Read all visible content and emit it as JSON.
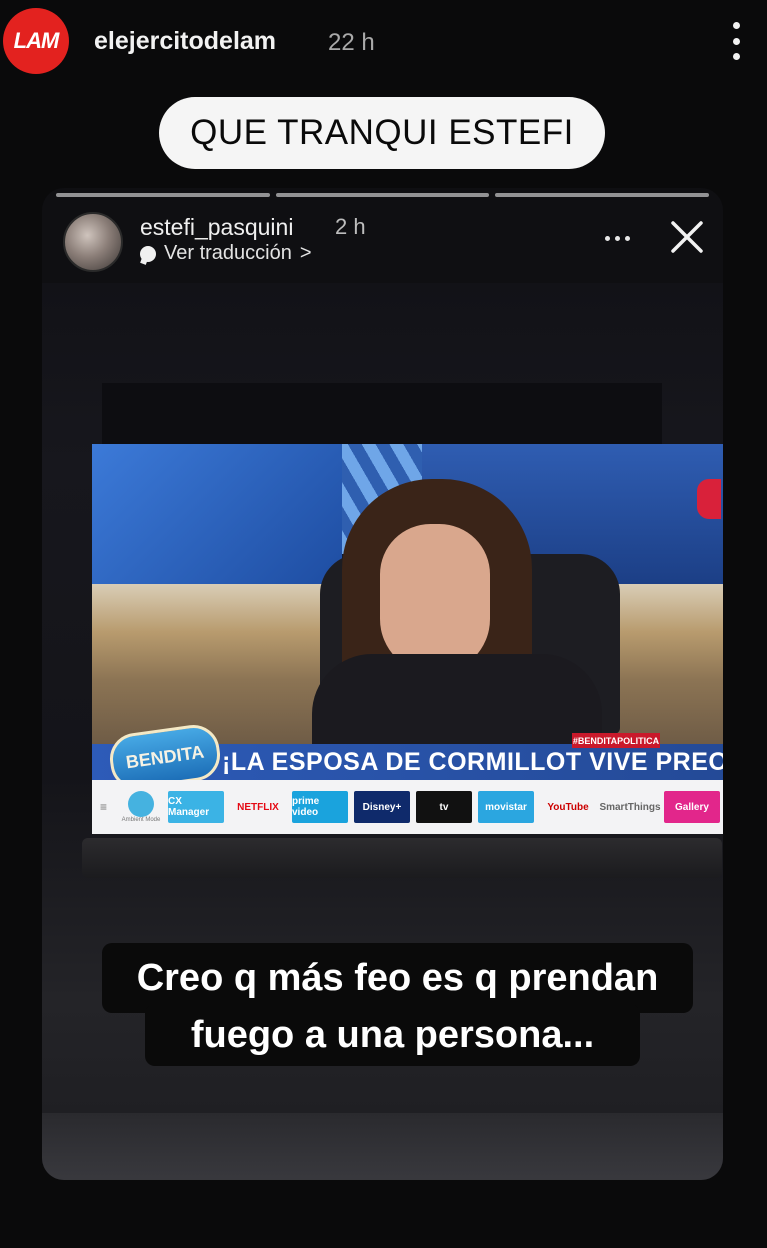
{
  "outer_story": {
    "avatar_text": "LAM",
    "username": "elejercitodelam",
    "time": "22 h",
    "caption": "QUE TRANQUI ESTEFI"
  },
  "inner_story": {
    "username": "estefi_pasquini",
    "time": "2 h",
    "translate_label": "Ver traducción",
    "translate_chevron": ">",
    "progress_segments": 3,
    "subtitle_line1": "Creo q más feo es q prendan",
    "subtitle_line2": "fuego a una persona..."
  },
  "tv": {
    "show_logo": "BENDITA",
    "hashtag": "#BENDITAPOLITICA",
    "banner": "¡LA ESPOSA DE CORMILLOT VIVE PREOCUPADA!",
    "apps": [
      {
        "label": "CX Manager",
        "color": "#3bb3e5",
        "text_color": "#ffffff"
      },
      {
        "label": "NETFLIX",
        "color": "#f3f3f5",
        "text_color": "#e50914"
      },
      {
        "label": "prime video",
        "color": "#1aa3dd",
        "text_color": "#ffffff"
      },
      {
        "label": "Disney+",
        "color": "#0f2a6b",
        "text_color": "#ffffff"
      },
      {
        "label": "tv",
        "color": "#111111",
        "text_color": "#ffffff"
      },
      {
        "label": "movistar",
        "color": "#2ba6e0",
        "text_color": "#ffffff"
      },
      {
        "label": "YouTube",
        "color": "#f3f3f5",
        "text_color": "#cc0000"
      },
      {
        "label": "SmartThings",
        "color": "#f3f3f5",
        "text_color": "#666666"
      },
      {
        "label": "Gallery",
        "color": "#e2268b",
        "text_color": "#ffffff"
      }
    ],
    "ambient_label": "Ambient Mode"
  },
  "icons": {
    "outer_more": "more-vertical-icon",
    "inner_more": "more-horizontal-icon",
    "close": "close-icon",
    "translate": "speech-bubble-icon"
  },
  "colors": {
    "lam_red": "#e3221f",
    "caption_bg": "#f5f5f5"
  }
}
